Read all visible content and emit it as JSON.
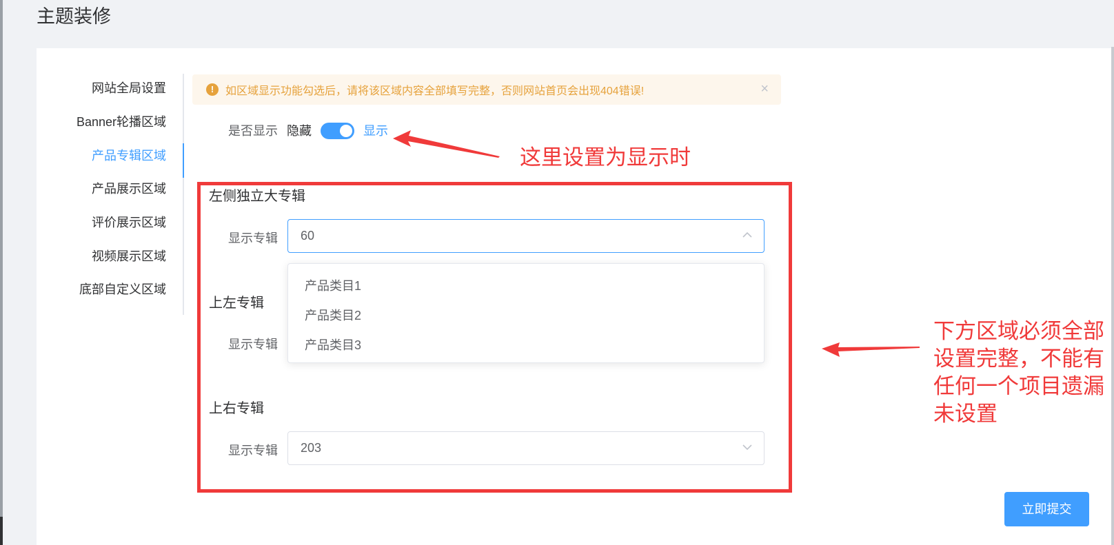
{
  "page": {
    "title": "主题装修"
  },
  "sidebar": {
    "items": [
      {
        "label": "网站全局设置"
      },
      {
        "label": "Banner轮播区域"
      },
      {
        "label": "产品专辑区域"
      },
      {
        "label": "产品展示区域"
      },
      {
        "label": "评价展示区域"
      },
      {
        "label": "视频展示区域"
      },
      {
        "label": "底部自定义区域"
      }
    ],
    "active": "产品专辑区域"
  },
  "alert": {
    "icon": "warning-icon",
    "text": "如区域显示功能勾选后，请将该区域内容全部填写完整，否则网站首页会出现404错误!",
    "close": "×"
  },
  "display_switch": {
    "label": "是否显示",
    "off_text": "隐藏",
    "on_text": "显示",
    "checked": true
  },
  "sections": [
    {
      "title": "左侧独立大专辑",
      "field_label": "显示专辑",
      "value": "60",
      "open": true
    },
    {
      "title": "上左专辑",
      "field_label": "显示专辑",
      "value": ""
    },
    {
      "title": "上右专辑",
      "field_label": "显示专辑",
      "value": "203"
    }
  ],
  "dropdown": {
    "options": [
      "产品类目1",
      "产品类目2",
      "产品类目3"
    ]
  },
  "annotations": {
    "top": "这里设置为显示时",
    "right_lines": [
      "下方区域必须全部",
      "设置完整，不能有",
      "任何一个项目遗漏",
      "未设置"
    ]
  },
  "submit": {
    "label": "立即提交"
  },
  "colors": {
    "primary": "#409eff",
    "warning": "#e6a23c",
    "annotation": "#f03a3a"
  }
}
